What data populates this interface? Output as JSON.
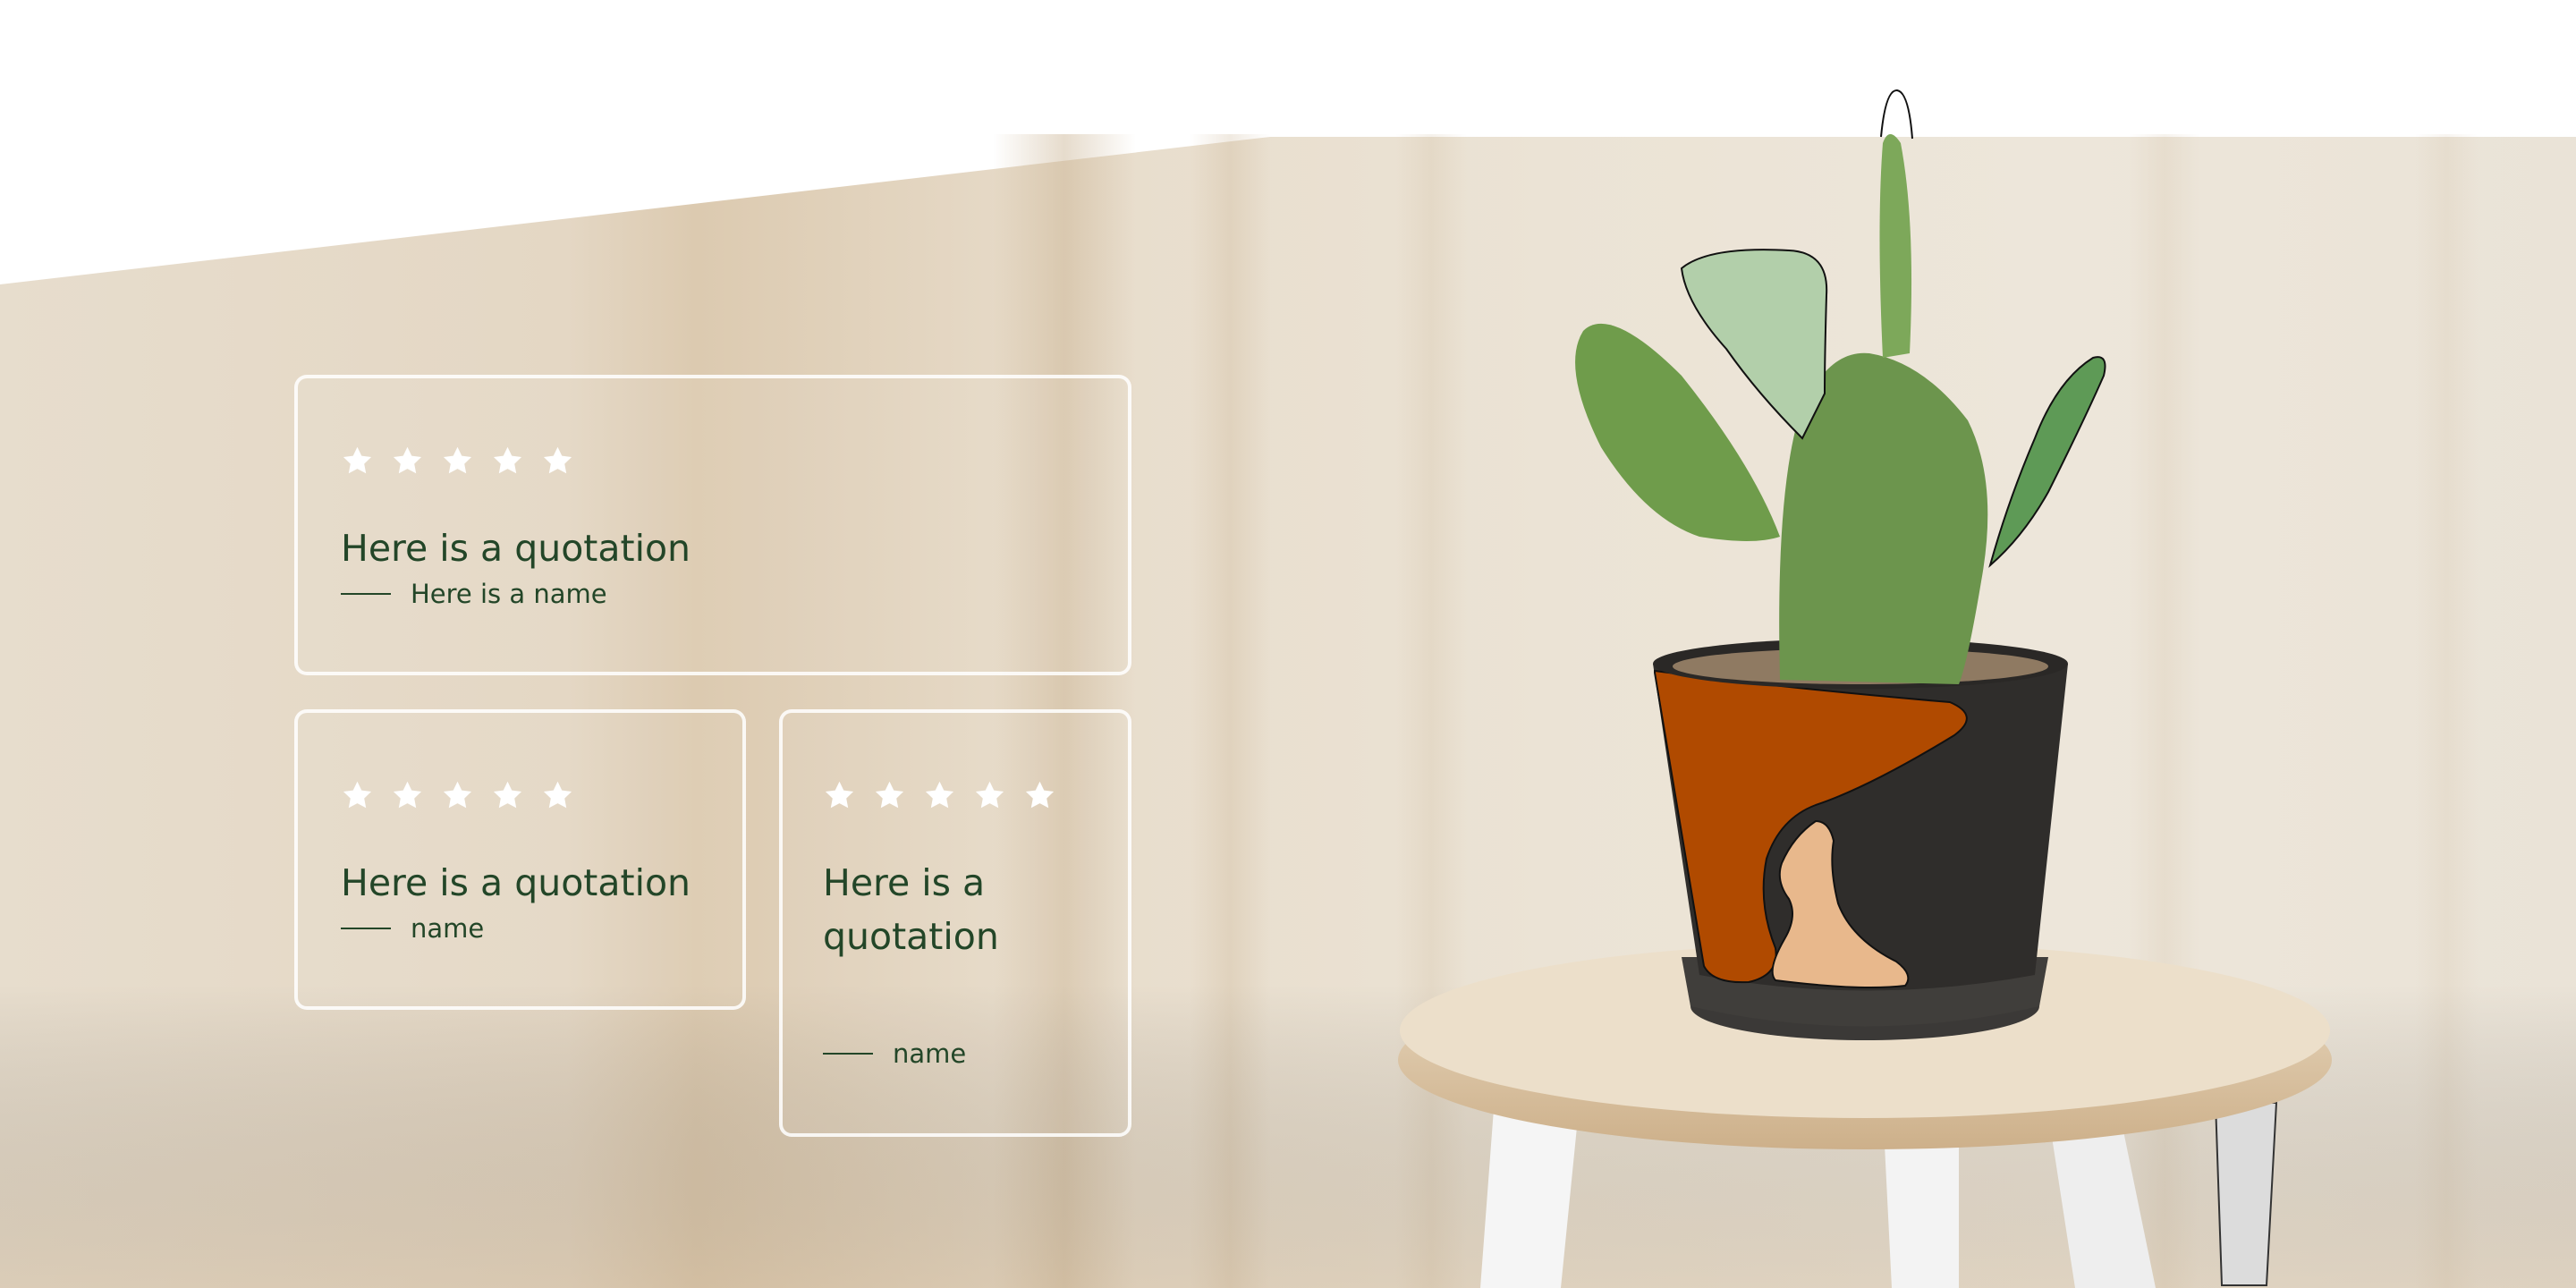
{
  "colors": {
    "background_top": "#ffffff",
    "wall": "#e6dccd",
    "card_border": "#ffffff",
    "star": "#ffffff",
    "text": "#234628",
    "pot_orange": "#b04a00",
    "pot_dark": "#2f2d2b",
    "pot_peach": "#e8b88c",
    "leaf_light": "#b2cfaa",
    "leaf_mid": "#5e9a56",
    "cactus": "#6f9c4b",
    "stool_top": "#e8d6bc",
    "stool_legs": "#f4f4f4"
  },
  "testimonials": [
    {
      "stars": 5,
      "quote": "Here is a quotation",
      "name": "Here is a name"
    },
    {
      "stars": 5,
      "quote": "Here is a quotation",
      "name": "name"
    },
    {
      "stars": 5,
      "quote_line1": "Here is a",
      "quote_line2": "quotation",
      "name": "name"
    }
  ],
  "illustration": {
    "subject": "potted cactus on a wooden stool",
    "icons": [
      "star-icon",
      "cactus-illustration",
      "pot-illustration",
      "stool-illustration"
    ]
  }
}
